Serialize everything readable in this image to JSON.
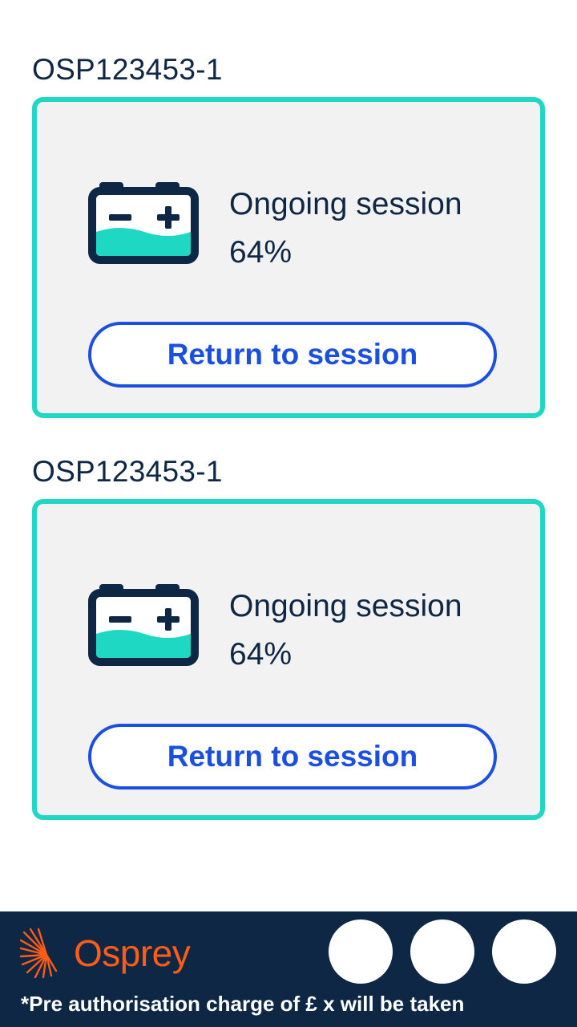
{
  "sessions": [
    {
      "charger_id": "OSP123453-1",
      "status_label": "Ongoing session",
      "charge_percent": "64%",
      "button_label": "Return to session"
    },
    {
      "charger_id": "OSP123453-1",
      "status_label": "Ongoing session",
      "charge_percent": "64%",
      "button_label": "Return to session"
    }
  ],
  "footer": {
    "brand_name": "Osprey",
    "note": "*Pre authorisation charge of £ x will be taken",
    "icons": [
      "circle-placeholder-icon",
      "circle-placeholder-icon",
      "circle-placeholder-icon"
    ]
  },
  "colors": {
    "navy": "#0d2745",
    "teal": "#1fd8c4",
    "blue": "#1a4fe0",
    "orange": "#ff5c16",
    "card_bg": "#f2f2f2"
  }
}
